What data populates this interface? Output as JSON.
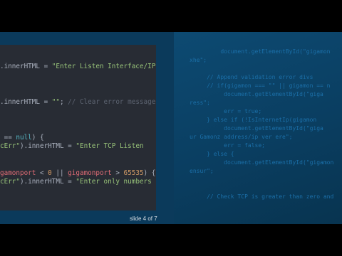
{
  "left_code": [
    [
      {
        "t": ".innerHTML = ",
        "c": "pl"
      },
      {
        "t": "\"Enter Listen Interface/IP",
        "c": "str"
      }
    ],
    [],
    [],
    [],
    [
      {
        "t": ".innerHTML = ",
        "c": "pl"
      },
      {
        "t": "\"\"",
        "c": "str"
      },
      {
        "t": "; ",
        "c": "pl"
      },
      {
        "t": "// Clear error message",
        "c": "cmt"
      }
    ],
    [],
    [],
    [],
    [
      {
        "t": " == ",
        "c": "pl"
      },
      {
        "t": "null",
        "c": "kw"
      },
      {
        "t": ") {",
        "c": "pl"
      }
    ],
    [
      {
        "t": "cErr\"",
        "c": "str"
      },
      {
        "t": ").innerHTML = ",
        "c": "pl"
      },
      {
        "t": "\"Enter TCP Listen",
        "c": "str"
      }
    ],
    [],
    [],
    [
      {
        "t": "gamonport",
        "c": "var"
      },
      {
        "t": " < ",
        "c": "pl"
      },
      {
        "t": "0",
        "c": "num"
      },
      {
        "t": " || ",
        "c": "pl"
      },
      {
        "t": "gigamonport",
        "c": "var"
      },
      {
        "t": " > ",
        "c": "pl"
      },
      {
        "t": "65535",
        "c": "num"
      },
      {
        "t": ") {",
        "c": "pl"
      }
    ],
    [
      {
        "t": "cErr\"",
        "c": "str"
      },
      {
        "t": ").innerHTML = ",
        "c": "pl"
      },
      {
        "t": "\"Enter only numbers in",
        "c": "str"
      }
    ]
  ],
  "right_code": [
    "         document.getElementById(\"gigamon",
    "xhe\";",
    "",
    "     // Append validation error divs",
    "     // if(gigamon === \"\" || gigamon == n",
    "          document.getElementById(\"giga",
    "ress\";",
    "          err = true;",
    "     } else if (!IsInternetIp(gigamon",
    "          document.getElementById(\"giga",
    "ur Gamonz address/ip ver ere\";",
    "          err = false;",
    "     } else {",
    "          document.getElementById(\"gigamon",
    "ensur\";",
    "",
    "",
    "     // Check TCP is greater than zero and"
  ],
  "slide_indicator": "slide 4 of 7"
}
